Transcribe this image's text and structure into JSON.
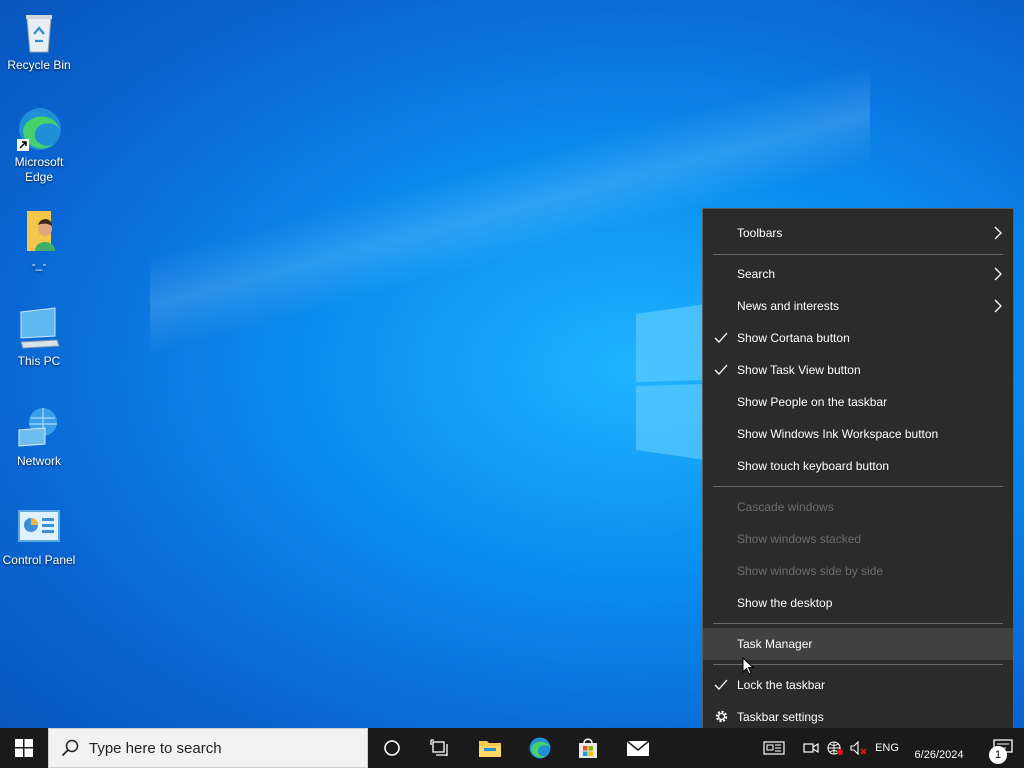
{
  "desktop": {
    "icons": [
      {
        "label": "Recycle Bin",
        "icon": "recycle-bin-icon"
      },
      {
        "label": "Microsoft Edge",
        "icon": "edge-icon"
      },
      {
        "label": "-_-",
        "icon": "user-folder-icon"
      },
      {
        "label": "This PC",
        "icon": "computer-icon"
      },
      {
        "label": "Network",
        "icon": "network-icon"
      },
      {
        "label": "Control Panel",
        "icon": "control-panel-icon"
      }
    ]
  },
  "context_menu": {
    "items": [
      {
        "label": "Toolbars",
        "submenu": true
      },
      {
        "label": "Search",
        "submenu": true
      },
      {
        "label": "News and interests",
        "submenu": true
      },
      {
        "label": "Show Cortana button",
        "checked": true
      },
      {
        "label": "Show Task View button",
        "checked": true
      },
      {
        "label": "Show People on the taskbar"
      },
      {
        "label": "Show Windows Ink Workspace button"
      },
      {
        "label": "Show touch keyboard button"
      },
      {
        "label": "Cascade windows",
        "disabled": true
      },
      {
        "label": "Show windows stacked",
        "disabled": true
      },
      {
        "label": "Show windows side by side",
        "disabled": true
      },
      {
        "label": "Show the desktop"
      },
      {
        "label": "Task Manager",
        "hovered": true
      },
      {
        "label": "Lock the taskbar",
        "checked": true
      },
      {
        "label": "Taskbar settings",
        "icon": "gear-icon"
      }
    ]
  },
  "taskbar": {
    "search_placeholder": "Type here to search",
    "pinned": [
      "cortana-icon",
      "task-view-icon",
      "file-explorer-icon",
      "edge-icon",
      "store-icon",
      "mail-icon"
    ],
    "tray": {
      "language": "ENG",
      "date": "6/26/2024",
      "notification_count": "1"
    }
  },
  "colors": {
    "menu_bg": "#2b2b2b",
    "menu_hover": "#414141",
    "taskbar_bg": "#1a1a1a",
    "desktop_accent": "#0a8ff0"
  }
}
